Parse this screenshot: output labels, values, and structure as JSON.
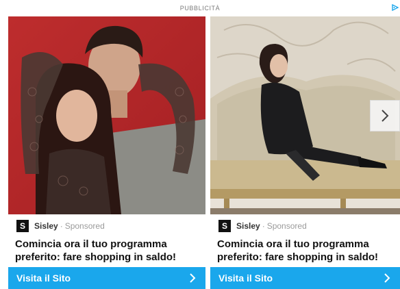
{
  "header": {
    "label": "PUBBLICITÀ",
    "adchoices_icon": "adchoices-icon"
  },
  "cards": [
    {
      "brand_logo": "S",
      "brand_name": "Sisley",
      "separator": "·",
      "sponsored": "Sponsored",
      "headline": "Comincia ora il tuo programma preferito: fare shopping in saldo!",
      "cta_label": "Visita il Sito",
      "cta_icon": "chevron-right-icon"
    },
    {
      "brand_logo": "S",
      "brand_name": "Sisley",
      "separator": "·",
      "sponsored": "Sponsored",
      "headline": "Comincia ora il tuo programma preferito: fare shopping in saldo!",
      "cta_label": "Visita il Sito",
      "cta_icon": "chevron-right-icon"
    }
  ],
  "carousel": {
    "next_icon": "chevron-right-icon"
  },
  "colors": {
    "cta_background": "#1aa7ec",
    "adchoices": "#1aa7ec",
    "photo1_background": "#b8262a",
    "photo2_background": "#e8e2d8"
  }
}
